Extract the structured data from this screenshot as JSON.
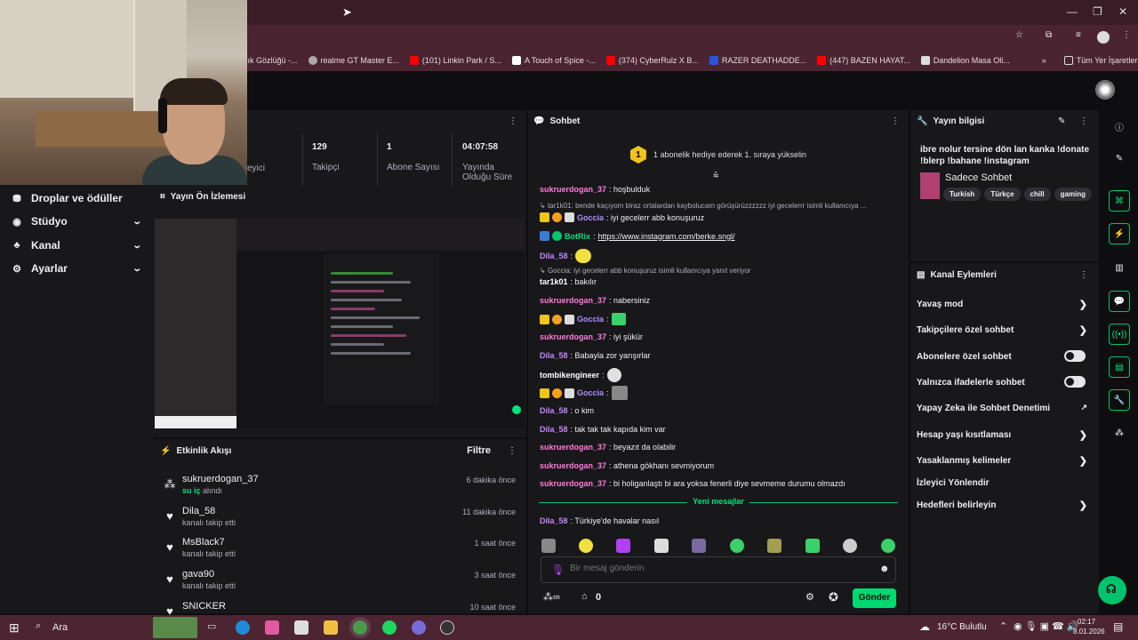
{
  "browser": {
    "bookmarks": [
      "şık Gözlüğü -...",
      "realme GT Master E...",
      "(101) Linkin Park / S...",
      "A Touch of Spice -...",
      "(374) CyberRulz X B...",
      "RAZER DEATHADDE...",
      "(447) BAZEN HAYAT...",
      "Dandelion Masa Oli...",
      "Tüm Yer İşaretleri"
    ]
  },
  "nav": {
    "items": [
      {
        "label": "Droplar ve ödüller",
        "icon": "gift-icon",
        "expandable": false
      },
      {
        "label": "Stüdyo",
        "icon": "studio-icon",
        "expandable": true
      },
      {
        "label": "Kanal",
        "icon": "channel-icon",
        "expandable": true
      },
      {
        "label": "Ayarlar",
        "icon": "gear-icon",
        "expandable": true
      }
    ]
  },
  "stats": {
    "viewers_label": "eyici",
    "followers_value": "129",
    "followers_label": "Takipçi",
    "subs_value": "1",
    "subs_label": "Abone Sayısı",
    "uptime_value": "04:07:58",
    "uptime_label_1": "Yayında",
    "uptime_label_2": "Olduğu Süre"
  },
  "preview": {
    "title": "Yayın Ön İzlemesi"
  },
  "activity": {
    "title": "Etkinlik Akışı",
    "filter": "Filtre",
    "rows": [
      {
        "name": "sukruerdogan_37",
        "sub_highlight": "su iç",
        "sub": "alındı",
        "time": "6 dakika önce",
        "icon": "points-icon"
      },
      {
        "name": "Dila_58",
        "sub": "kanalı takip etti",
        "time": "11 dakika önce",
        "icon": "heart-icon"
      },
      {
        "name": "MsBlack7",
        "sub": "kanalı takip etti",
        "time": "1 saat önce",
        "icon": "heart-icon"
      },
      {
        "name": "gava90",
        "sub": "kanalı takip etti",
        "time": "3 saat önce",
        "icon": "heart-icon"
      },
      {
        "name": "SNICKER",
        "sub": "",
        "time": "10 saat önce",
        "icon": "heart-icon"
      }
    ]
  },
  "chat": {
    "title": "Sohbet",
    "hype_count": "1",
    "hype_text": "1 abonelik hediye ederek 1. sıraya yükselin",
    "new_messages": "Yeni mesajlar",
    "input_placeholder": "Bir mesaj gönderin",
    "points": "0",
    "send": "Gönder",
    "messages": [
      {
        "user": "sukruerdogan_37",
        "color": "#ff7ad9",
        "text": ": hoşbulduk"
      },
      {
        "reply": "tar1k01: bende kaçıyom biraz ortalardan kaybolucam görüşürüzzzzzz iyi gecelerrr isimli kullanıcıya ..."
      },
      {
        "user": "Goccia",
        "color": "#b08cff",
        "text": ": iyi gecelerr abb konuşuruz"
      },
      {
        "user": "BotRix",
        "color": "#00e57a",
        "text": ":",
        "link": "https://www.instagram.com/berke.sngl/"
      },
      {
        "user": "Dila_58",
        "color": "#c285ff",
        "text": ":"
      },
      {
        "reply": "Goccia: iyi gecelerr abb konuşuruz isimli kullanıcıya yanıt veriyor"
      },
      {
        "user": "tar1k01",
        "color": "#ffffff",
        "text": ": bakılır"
      },
      {
        "user": "sukruerdogan_37",
        "color": "#ff7ad9",
        "text": ": nabersiniz"
      },
      {
        "user": "Goccia",
        "color": "#b08cff",
        "text": ":"
      },
      {
        "user": "sukruerdogan_37",
        "color": "#ff7ad9",
        "text": ": iyi şükür"
      },
      {
        "user": "Dila_58",
        "color": "#c285ff",
        "text": ": Babayla zor yarışırlar"
      },
      {
        "user": "tombikengineer",
        "color": "#ffffff",
        "text": ":"
      },
      {
        "user": "Goccia",
        "color": "#b08cff",
        "text": ":"
      },
      {
        "user": "Dila_58",
        "color": "#c285ff",
        "text": ": o kim"
      },
      {
        "user": "Dila_58",
        "color": "#c285ff",
        "text": ": tak tak tak kapıda kim var"
      },
      {
        "user": "sukruerdogan_37",
        "color": "#ff7ad9",
        "text": ": beyazıt da olabilir"
      },
      {
        "user": "sukruerdogan_37",
        "color": "#ff7ad9",
        "text": ": athena gökhanı sevmiyorum"
      },
      {
        "user": "sukruerdogan_37",
        "color": "#ff7ad9",
        "text": ": bi holiganlaştı bi ara yoksa fenerli diye sevmeme durumu olmazdı"
      },
      {
        "user": "Dila_58",
        "color": "#c285ff",
        "text": ": Türkiye'de havalar nasıl"
      }
    ]
  },
  "info": {
    "title": "Yayın bilgisi",
    "stream_title": "ibre nolur tersine dön lan kanka !donate !blerp !bahane !instagram",
    "category": "Sadece Sohbet",
    "tags": [
      "Turkish",
      "Türkçe",
      "chill",
      "gaming"
    ]
  },
  "actions": {
    "title": "Kanal Eylemleri",
    "items": [
      {
        "label": "Yavaş mod",
        "ctrl": "chevron"
      },
      {
        "label": "Takipçilere özel sohbet",
        "ctrl": "chevron"
      },
      {
        "label": "Abonelere özel sohbet",
        "ctrl": "toggle"
      },
      {
        "label": "Yalnızca ifadelerle sohbet",
        "ctrl": "toggle"
      },
      {
        "label": "Yapay Zeka ile Sohbet Denetimi",
        "ctrl": "external"
      },
      {
        "label": "Hesap yaşı kısıtlaması",
        "ctrl": "chevron"
      },
      {
        "label": "Yasaklanmış kelimeler",
        "ctrl": "chevron"
      },
      {
        "label": "İzleyici Yönlendir",
        "ctrl": "none"
      },
      {
        "label": "Hedefleri belirleyin",
        "ctrl": "chevron"
      }
    ]
  },
  "taskbar": {
    "search": "Ara",
    "weather": "16°C Bulutlu",
    "time": "02:17",
    "date": "8.01.2026"
  },
  "colors": {
    "accent": "#00c46b",
    "bg": "#0e0e10",
    "panel": "#18181b"
  }
}
